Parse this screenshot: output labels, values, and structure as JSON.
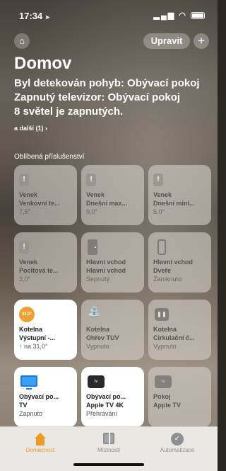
{
  "status_bar": {
    "time": "17:34",
    "location_glyph": "➤",
    "signal": "▂▄▆",
    "wifi": "◠"
  },
  "header": {
    "home_icon": "house-icon",
    "edit_label": "Upravit",
    "add_label": "+"
  },
  "title": "Domov",
  "status_lines": [
    "Byl detekován pohyb: Obývací pokoj",
    "Zapnutý televizor: Obývací pokoj",
    "8 světel je zapnutých."
  ],
  "more_link": "a další (1) ›",
  "section_label": "Oblíbená příslušenství",
  "tiles": [
    {
      "room": "Venek",
      "name": "Venkovní te...",
      "state": "7,5°",
      "on": false,
      "icon": "sensor-icon"
    },
    {
      "room": "Venek",
      "name": "Dnešní max...",
      "state": "9,0°",
      "on": false,
      "icon": "sensor-icon"
    },
    {
      "room": "Venek",
      "name": "Dnešní mini...",
      "state": "5,0°",
      "on": false,
      "icon": "sensor-icon"
    },
    {
      "room": "Venek",
      "name": "Pocitová te...",
      "state": "3,0°",
      "on": false,
      "icon": "sensor-icon"
    },
    {
      "room": "Hlavní vchod",
      "name": "Hlavní vchod",
      "state": "Sepnutý",
      "on": false,
      "icon": "door-icon"
    },
    {
      "room": "Hlavní vchod",
      "name": "Dveře",
      "state": "Zamknuto",
      "on": false,
      "icon": "lock-icon"
    },
    {
      "room": "Kotelna",
      "name": "Výstupní -...",
      "state": "↑ na 31,0°",
      "on": true,
      "icon": "thermostat-icon",
      "badge": "32,0°"
    },
    {
      "room": "Kotelna",
      "name": "Ohřev TUV",
      "state": "Vypnuto",
      "on": false,
      "icon": "tap-icon"
    },
    {
      "room": "Kotelna",
      "name": "Cirkulační č...",
      "state": "Vypnuto",
      "on": false,
      "icon": "outlet-icon"
    },
    {
      "room": "Obývací po...",
      "name": "TV",
      "state": "Zapnuto",
      "on": true,
      "icon": "tv-icon"
    },
    {
      "room": "Obývací po...",
      "name": "Apple TV 4K",
      "state": "Přehrávání",
      "on": true,
      "icon": "apple-tv-icon",
      "badge": "tv"
    },
    {
      "room": "Pokoj",
      "name": "Apple TV",
      "state": "",
      "on": false,
      "icon": "apple-tv-icon",
      "badge": "tv"
    }
  ],
  "tabs": [
    {
      "label": "Domácnost",
      "icon": "house-icon",
      "active": true
    },
    {
      "label": "Místnosti",
      "icon": "rooms-icon",
      "active": false
    },
    {
      "label": "Automatizace",
      "icon": "automation-icon",
      "active": false
    }
  ],
  "colors": {
    "accent": "#f09a25",
    "thermostat": "#f0a030",
    "tv_blue": "#3aa0f5"
  }
}
